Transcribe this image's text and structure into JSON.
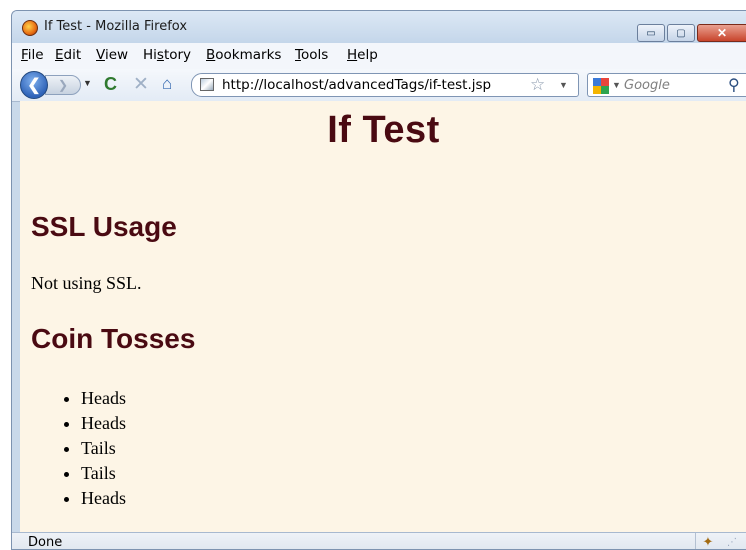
{
  "window": {
    "title": "If Test - Mozilla Firefox",
    "controls": {
      "minimize": "▭",
      "maximize": "▢",
      "close": "✕"
    }
  },
  "menu": {
    "items": [
      {
        "label": "File",
        "accel": "F",
        "rest": "ile"
      },
      {
        "label": "Edit",
        "accel": "E",
        "rest": "dit"
      },
      {
        "label": "View",
        "accel": "V",
        "rest": "iew"
      },
      {
        "label": "History",
        "pre": "Hi",
        "accel": "s",
        "rest": "tory"
      },
      {
        "label": "Bookmarks",
        "accel": "B",
        "rest": "ookmarks"
      },
      {
        "label": "Tools",
        "accel": "T",
        "rest": "ools"
      },
      {
        "label": "Help",
        "accel": "H",
        "rest": "elp"
      }
    ]
  },
  "navigation": {
    "back_glyph": "❮",
    "forward_glyph": "❯",
    "dropdown_glyph": "▼",
    "reload_glyph": "C",
    "stop_glyph": "✕",
    "home_glyph": "⌂",
    "url": "http://localhost/advancedTags/if-test.jsp",
    "bookmark_glyph": "☆",
    "search_placeholder": "Google",
    "search_glyph": "⚲"
  },
  "page": {
    "heading": "If Test",
    "ssl_heading": "SSL Usage",
    "ssl_text": "Not using SSL.",
    "coin_heading": "Coin Tosses",
    "coin_results": [
      "Heads",
      "Heads",
      "Tails",
      "Tails",
      "Heads"
    ]
  },
  "status": {
    "text": "Done",
    "addon_glyph": "✦",
    "grip_glyph": "⋰"
  },
  "colors": {
    "page_background": "#fdf5e6",
    "heading_color": "#4a0a12"
  }
}
